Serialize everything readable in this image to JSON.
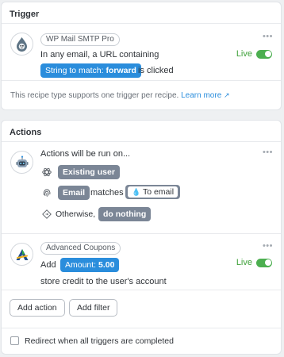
{
  "trigger": {
    "title": "Trigger",
    "integration": "WP Mail SMTP Pro",
    "sentence_prefix": "In any email, a URL containing",
    "token": {
      "label": "String to match:",
      "value": "forward"
    },
    "sentence_suffix": "is clicked",
    "status": "Live",
    "note": "This recipe type supports one trigger per recipe.",
    "learn_more": "Learn more"
  },
  "actions": {
    "title": "Actions",
    "run_on": {
      "label": "Actions will be run on...",
      "user_token": "Existing user",
      "email_token": "Email",
      "matches": "matches",
      "to_email_token": "To email",
      "otherwise": "Otherwise,",
      "fallback_token": "do nothing"
    },
    "coupon": {
      "integration": "Advanced Coupons",
      "prefix": "Add",
      "token": {
        "label": "Amount:",
        "value": "5.00"
      },
      "suffix": "store credit to the user's account",
      "status": "Live"
    },
    "add_action": "Add action",
    "add_filter": "Add filter",
    "redirect_label": "Redirect when all triggers are completed"
  },
  "colors": {
    "blue_token": "#2a8ddc",
    "gray_token": "#7b8696",
    "live": "#3fa13a",
    "link": "#2a8ddc"
  },
  "more_glyph": "•••"
}
